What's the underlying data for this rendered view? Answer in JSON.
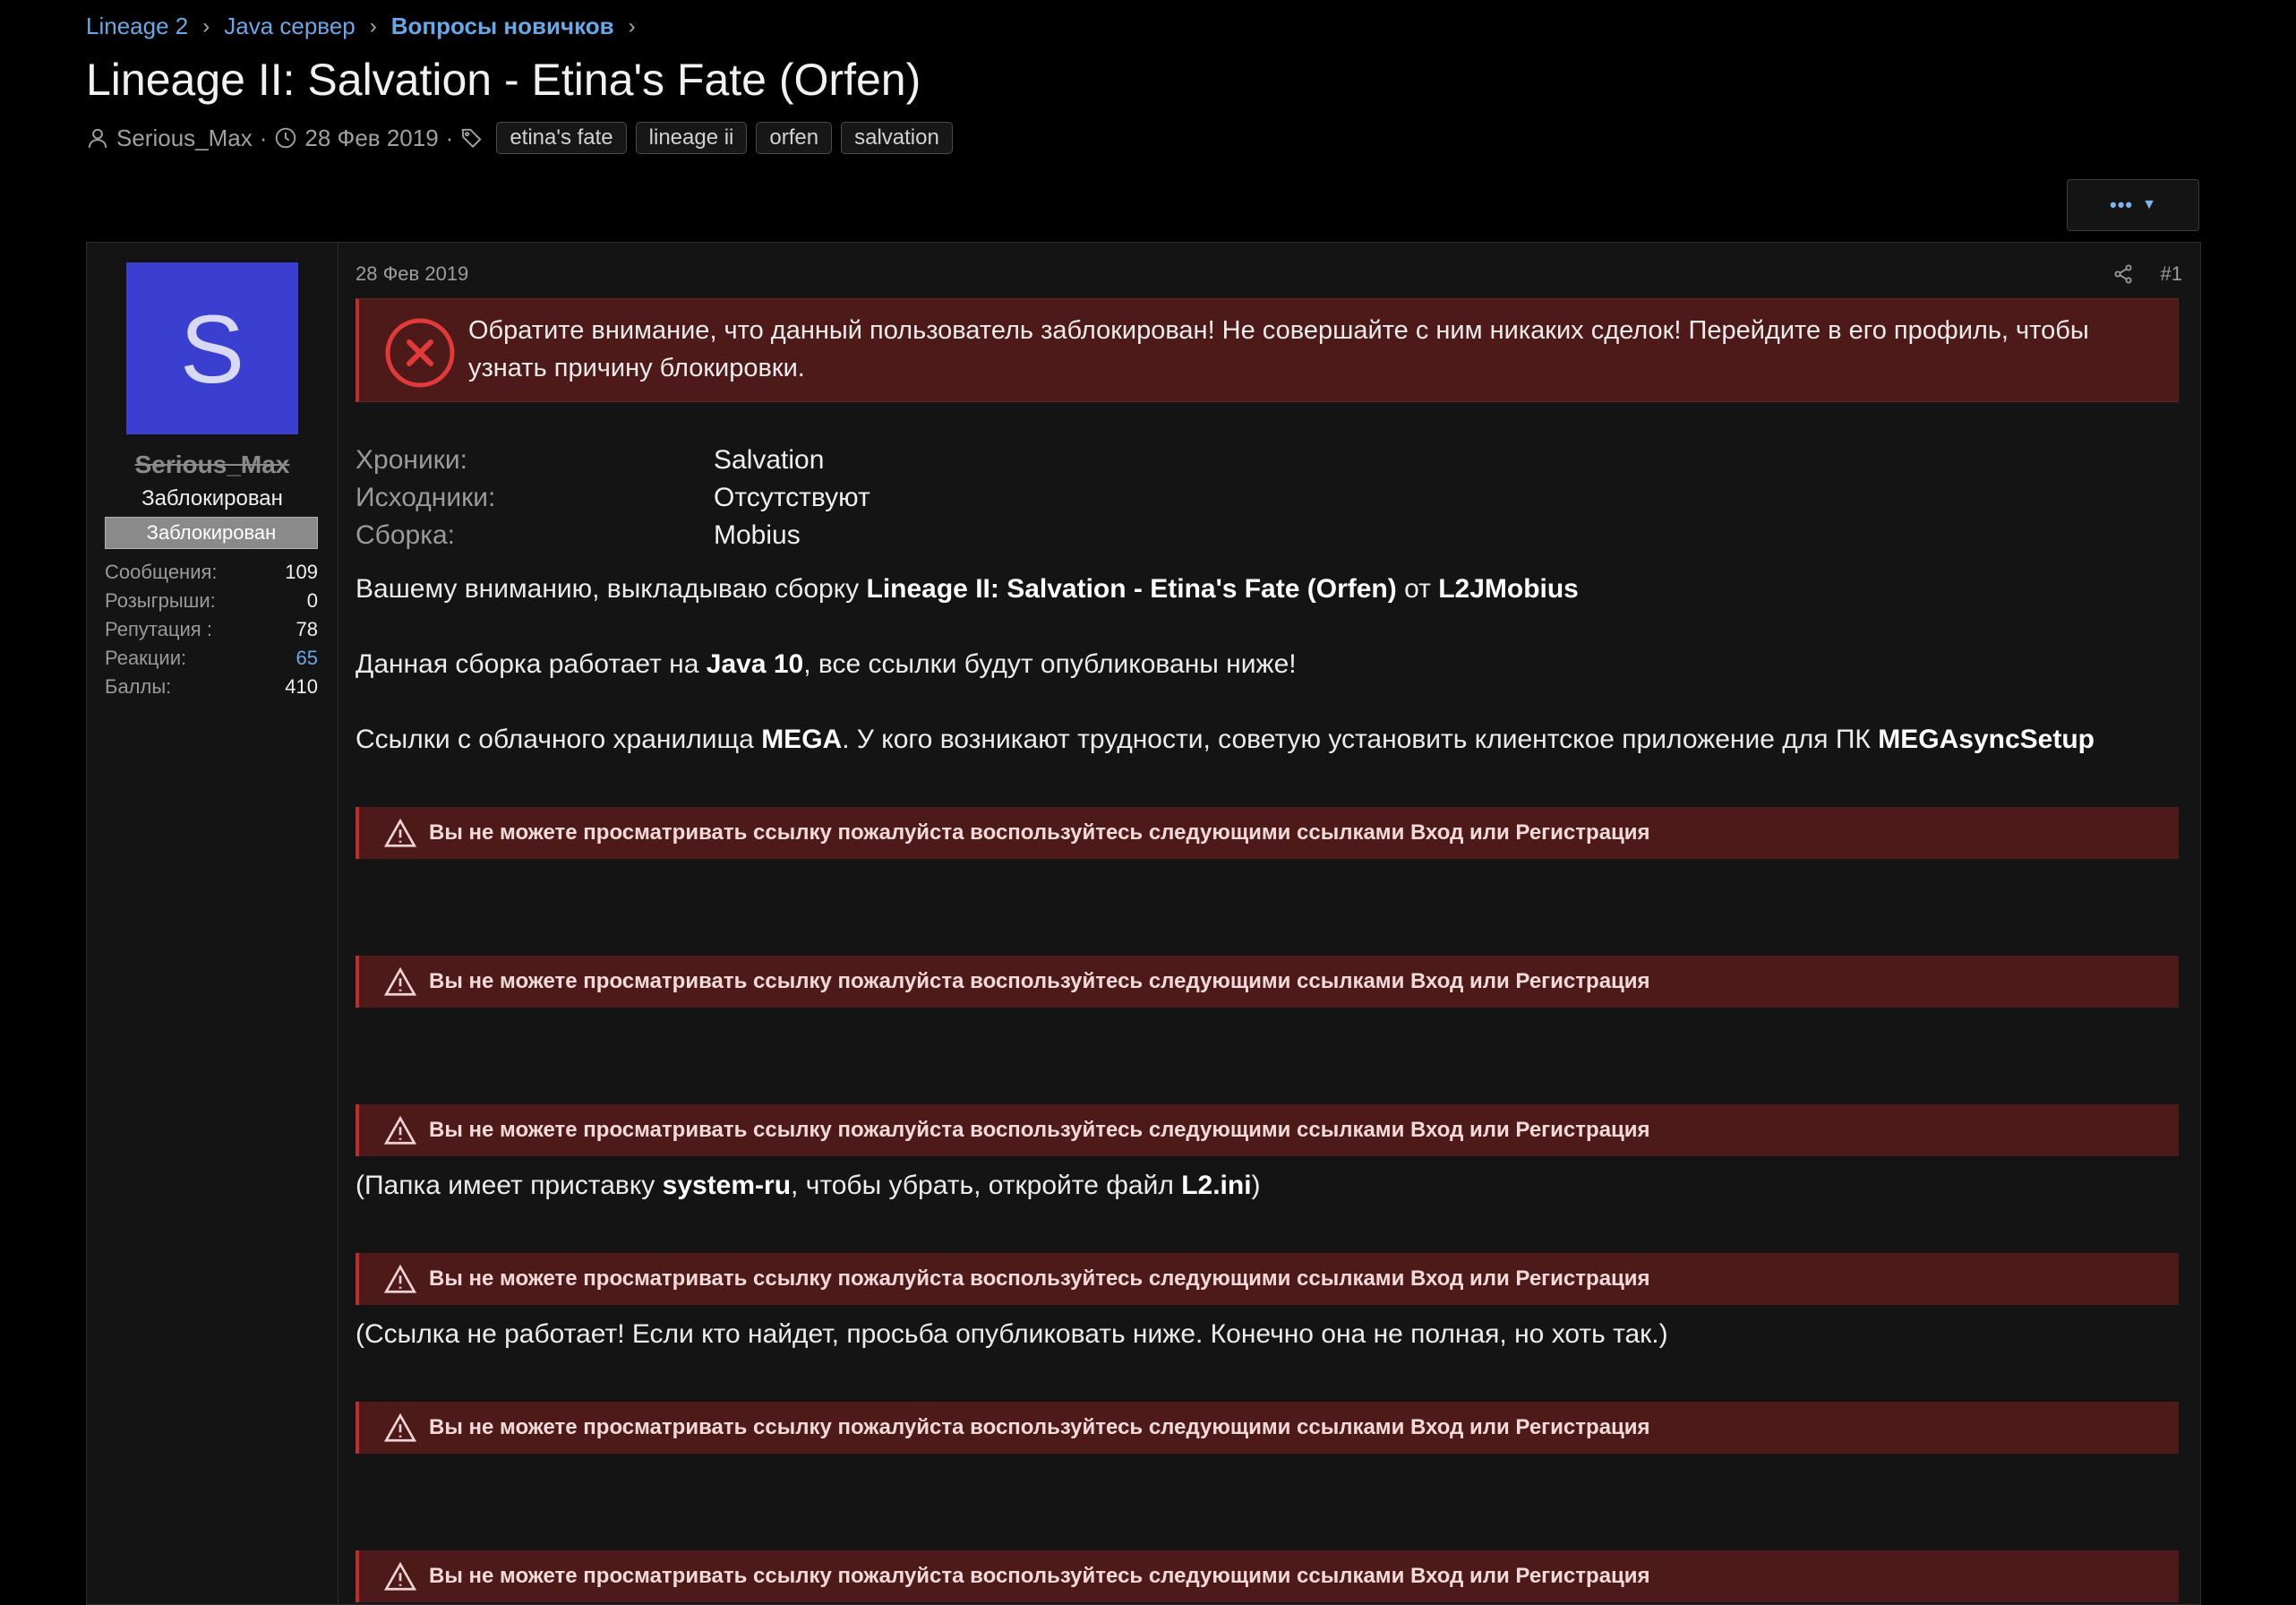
{
  "breadcrumb": [
    {
      "label": "Lineage 2"
    },
    {
      "label": "Java сервер"
    },
    {
      "label": "Вопросы новичков"
    }
  ],
  "thread": {
    "title": "Lineage II: Salvation - Etina's Fate (Orfen)",
    "author": "Serious_Max",
    "date": "28 Фев 2019",
    "tags": [
      "etina's fate",
      "lineage ii",
      "orfen",
      "salvation"
    ],
    "more_label": "•••"
  },
  "user": {
    "avatar_letter": "S",
    "avatar_color": "#3b3fcf",
    "name": "Serious_Max",
    "title": "Заблокирован",
    "banner": "Заблокирован",
    "stats": [
      {
        "label": "Сообщения:",
        "value": "109"
      },
      {
        "label": "Розыгрыши:",
        "value": "0"
      },
      {
        "label": "Репутация :",
        "value": "78"
      },
      {
        "label": "Реакции:",
        "value": "65"
      },
      {
        "label": "Баллы:",
        "value": "410"
      }
    ]
  },
  "post": {
    "date": "28 Фев 2019",
    "number": "#1",
    "warning": "Обратите внимание, что данный пользователь заблокирован! Не совершайте с ним никаких сделок! Перейдите в его профиль, чтобы узнать причину блокировки.",
    "fields": [
      {
        "label": "Хроники:",
        "value": "Salvation"
      },
      {
        "label": "Исходники:",
        "value": "Отсутствуют"
      },
      {
        "label": "Сборка:",
        "value": "Mobius"
      }
    ],
    "p1": {
      "a": "Вашему вниманию, выкладываю сборку ",
      "b": "Lineage II: Salvation - Etina's Fate (Orfen)",
      "c": " от ",
      "d": "L2JMobius"
    },
    "p2": {
      "a": "Данная сборка работает на ",
      "b": "Java 10",
      "c": ", все ссылки будут опубликованы ниже!"
    },
    "p3": {
      "a": "Ссылки с облачного хранилища ",
      "b": "MEGA",
      "c": ". У кого возникают трудности, советую установить клиентское приложение для ПК ",
      "d": "MEGAsyncSetup"
    },
    "p4": {
      "a": "(Папка имеет приставку ",
      "b": "system-ru",
      "c": ", чтобы убрать, откройте файл ",
      "d": "L2.ini",
      "e": ")"
    },
    "p5": "(Ссылка не работает! Если кто найдет, просьба опубликовать ниже. Конечно она не полная, но хоть так.)",
    "locked_link_text": "Вы не можете просматривать ссылку пожалуйста воспользуйтесь следующими ссылками Вход или Регистрация"
  },
  "colors": {
    "link": "#6aa7e6",
    "warning_bg": "#4e1919",
    "warning_border": "#c52b2b",
    "background": "#000000",
    "panel": "#141414"
  }
}
